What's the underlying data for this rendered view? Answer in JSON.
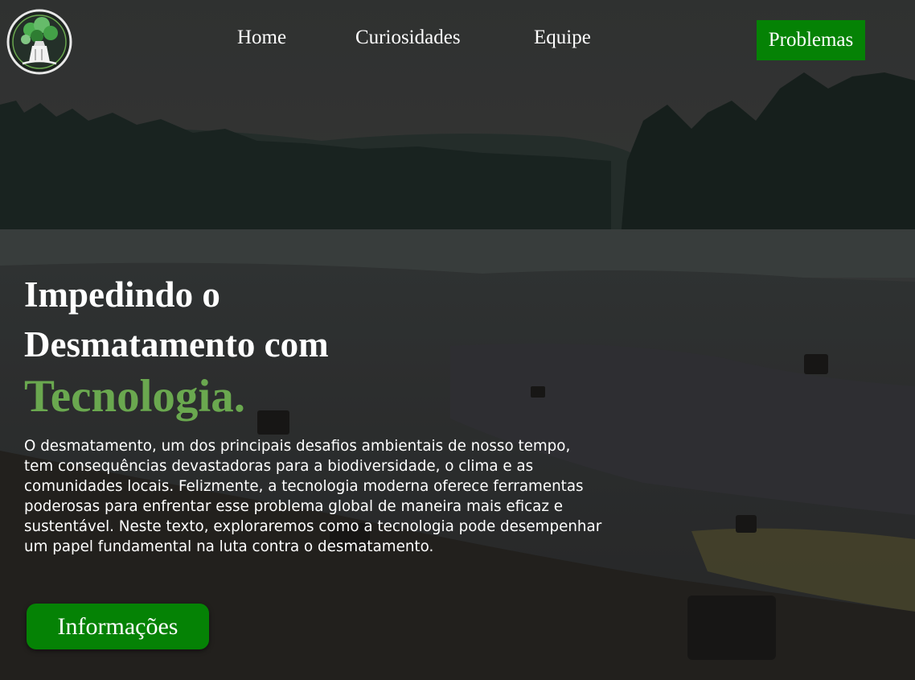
{
  "nav": {
    "logo_icon": "tree-stump-logo-icon",
    "links": [
      "Home",
      "Curiosidades",
      "Equipe"
    ],
    "cta_label": "Problemas"
  },
  "hero": {
    "headline_line1": "Impedindo o",
    "headline_line2": "Desmatamento com",
    "headline_accent": "Tecnologia.",
    "paragraph": "O desmatamento, um dos principais desafios ambientais de nosso tempo, tem consequências devastadoras para a biodiversidade, o clima e as comunidades locais. Felizmente, a tecnologia moderna oferece ferramentas poderosas para enfrentar esse problema global de maneira mais eficaz e sustentável. Neste texto, exploraremos como a tecnologia pode desempenhar um papel fundamental na luta contra o desmatamento.",
    "button_label": "Informações",
    "background_image": "deforested-lakeshore-photo"
  },
  "colors": {
    "accent_green": "#058205",
    "headline_accent": "#6aa84f",
    "text": "#ffffff"
  }
}
